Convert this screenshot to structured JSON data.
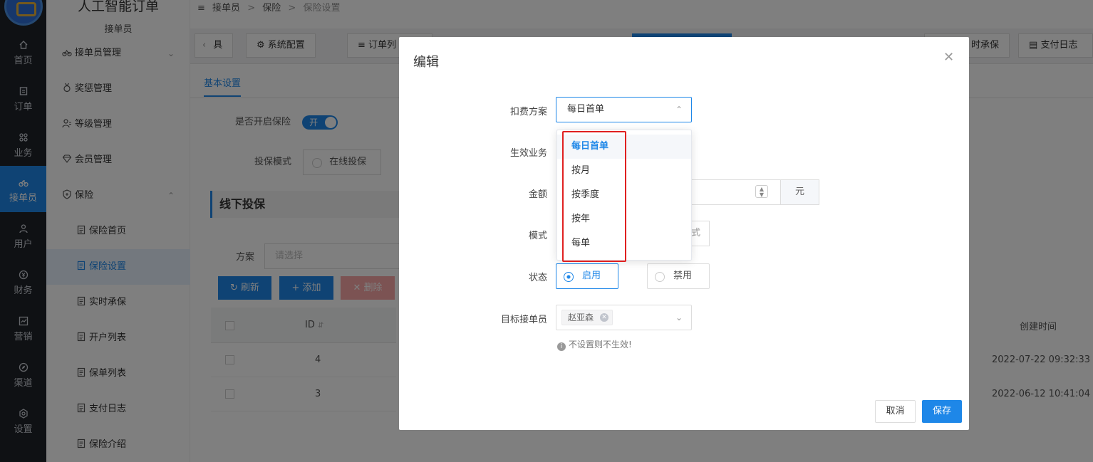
{
  "app": {
    "title": "人工智能订单",
    "role": "接单员"
  },
  "rail": [
    {
      "label": "首页",
      "icon": "home-icon"
    },
    {
      "label": "订单",
      "icon": "order-icon"
    },
    {
      "label": "业务",
      "icon": "business-icon"
    },
    {
      "label": "接单员",
      "icon": "bike-icon",
      "active": true
    },
    {
      "label": "用户",
      "icon": "user-icon"
    },
    {
      "label": "财务",
      "icon": "finance-icon"
    },
    {
      "label": "营销",
      "icon": "chart-icon"
    },
    {
      "label": "渠道",
      "icon": "compass-icon"
    },
    {
      "label": "设置",
      "icon": "settings-icon"
    }
  ],
  "sidebar": {
    "items": [
      {
        "label": "接单员管理"
      },
      {
        "label": "奖惩管理"
      },
      {
        "label": "等级管理"
      },
      {
        "label": "会员管理"
      },
      {
        "label": "保险"
      },
      {
        "label": "保险首页"
      },
      {
        "label": "保险设置"
      },
      {
        "label": "实时承保"
      },
      {
        "label": "开户列表"
      },
      {
        "label": "保单列表"
      },
      {
        "label": "支付日志"
      },
      {
        "label": "保险介绍"
      }
    ]
  },
  "breadcrumb": {
    "a": "接单员",
    "b": "保险",
    "c": "保险设置",
    "sep": ">"
  },
  "tabs": {
    "t1": "具",
    "t2": "系统配置",
    "t3": "订单列",
    "t4": "时承保",
    "t5": "支付日志"
  },
  "page": {
    "subtab": "基本设置",
    "insurance_label": "是否开启保险",
    "switch_on": "开",
    "mode_label": "投保模式",
    "mode_online": "在线投保",
    "section": "线下投保",
    "filter_label": "方案",
    "filter_placeholder": "请选择",
    "btn_refresh": "刷新",
    "btn_add": "添加",
    "btn_delete": "删除",
    "col_id": "ID",
    "col_created": "创建时间",
    "rows": [
      {
        "id": "4",
        "created": "2022-07-22 09:32:33"
      },
      {
        "id": "3",
        "created": "2022-06-12 10:41:04"
      }
    ]
  },
  "dialog": {
    "title": "编辑",
    "labels": {
      "plan": "扣费方案",
      "business": "生效业务",
      "amount": "金额",
      "mode": "模式",
      "status": "状态",
      "target": "目标接单员"
    },
    "plan_value": "每日首单",
    "plan_options": [
      "每日首单",
      "按月",
      "按季度",
      "按年",
      "每单"
    ],
    "amount_unit": "元",
    "mode_fragment": "式",
    "status_on": "启用",
    "status_off": "禁用",
    "target_tag": "赵亚森",
    "hint": "不设置则不生效!",
    "cancel": "取消",
    "save": "保存"
  }
}
